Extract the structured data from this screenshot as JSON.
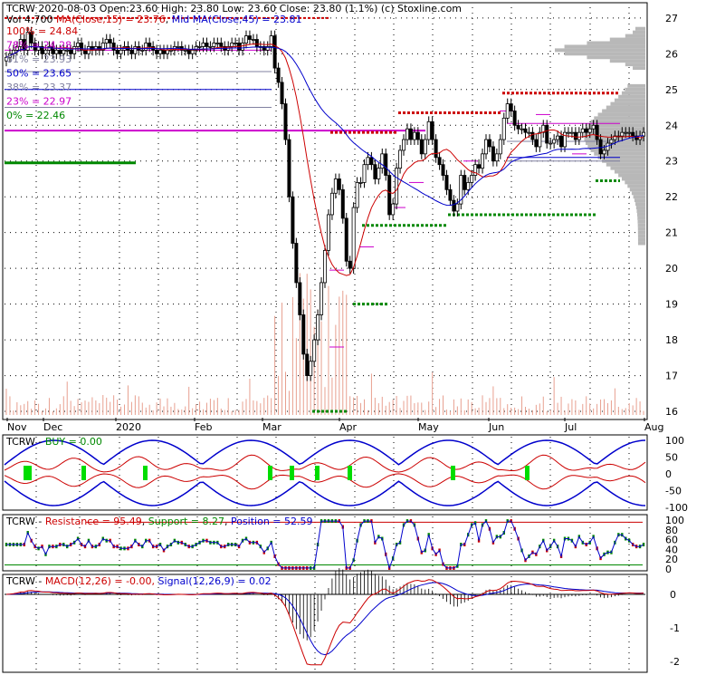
{
  "header": {
    "symbol": "TCRW",
    "date": "2020-08-03",
    "open_label": "Open:",
    "open": "23.60",
    "high_label": "High:",
    "high": "23.80",
    "low_label": "Low:",
    "low": "23.60",
    "close_label": "Close:",
    "close": "23.80",
    "change": "(1.1%)",
    "source": "(c) Stoxline.com"
  },
  "legend": {
    "vol": "Vol 4,700",
    "ma15": "MA(Close,15) = 23.76",
    "ma45": "Mid MA(Close,45) = 23.81"
  },
  "fib_levels": [
    {
      "label": "100% = 24.84",
      "pct": "100%",
      "value": 24.84,
      "color": "#cc0000"
    },
    {
      "label": "78% = 24.28",
      "pct": "78%",
      "value": 24.28,
      "color": "#cc00cc"
    },
    {
      "label": "61% = 23.93",
      "pct": "61%",
      "value": 23.93,
      "color": "#8080a0"
    },
    {
      "label": "50% = 23.65",
      "pct": "50%",
      "value": 23.65,
      "color": "#0000cc"
    },
    {
      "label": "38% = 23.37",
      "pct": "38%",
      "value": 23.37,
      "color": "#8080a0"
    },
    {
      "label": "23% = 22.97",
      "pct": "23%",
      "value": 22.97,
      "color": "#cc00cc"
    },
    {
      "label": "0% = 22.46",
      "pct": "0%",
      "value": 22.46,
      "color": "#008800"
    }
  ],
  "chart_data": {
    "type": "candlestick",
    "price_axis": {
      "ylim": [
        15.9,
        27.3
      ],
      "ticks": [
        16,
        17,
        18,
        19,
        20,
        21,
        22,
        23,
        24,
        25,
        26,
        27
      ]
    },
    "months": [
      "Nov",
      "Dec",
      "2020",
      "Feb",
      "Mar",
      "Apr",
      "May",
      "Jun",
      "Jul",
      "Aug"
    ],
    "closes": [
      25.9,
      26.0,
      26.1,
      26.2,
      26.4,
      26.1,
      26.6,
      26.3,
      26.1,
      26.2,
      26.0,
      26.1,
      26.2,
      26.0,
      26.1,
      26.0,
      26.1,
      26.1,
      26.0,
      26.2,
      26.3,
      26.1,
      26.0,
      26.2,
      26.1,
      26.2,
      26.1,
      26.3,
      26.4,
      26.3,
      26.1,
      26.0,
      26.1,
      26.2,
      26.1,
      26.0,
      26.2,
      26.1,
      26.1,
      26.3,
      26.2,
      26.1,
      26.0,
      26.1,
      26.0,
      26.1,
      26.1,
      26.2,
      26.2,
      26.1,
      26.1,
      26.0,
      26.1,
      26.2,
      26.2,
      26.3,
      26.2,
      26.2,
      26.3,
      26.3,
      26.2,
      26.1,
      26.2,
      26.3,
      26.3,
      26.1,
      26.3,
      26.5,
      26.4,
      26.4,
      26.2,
      26.2,
      26.1,
      26.2,
      26.5,
      25.6,
      25.2,
      24.6,
      23.6,
      22.0,
      20.7,
      19.6,
      18.7,
      17.6,
      17.0,
      17.4,
      18.0,
      18.7,
      19.6,
      20.5,
      21.5,
      22.1,
      22.5,
      22.2,
      21.4,
      20.2,
      20.0,
      21.7,
      22.4,
      22.4,
      22.9,
      23.1,
      22.9,
      22.5,
      22.8,
      23.2,
      22.6,
      21.5,
      21.8,
      22.8,
      23.3,
      23.6,
      23.9,
      23.6,
      23.8,
      23.6,
      23.2,
      23.6,
      24.1,
      23.6,
      23.1,
      22.9,
      22.6,
      22.2,
      21.9,
      21.6,
      21.8,
      22.6,
      22.2,
      22.4,
      22.6,
      22.9,
      22.8,
      23.2,
      23.6,
      23.4,
      23.0,
      23.2,
      23.6,
      24.2,
      24.6,
      24.4,
      24.0,
      23.9,
      23.9,
      23.8,
      23.8,
      23.6,
      23.4,
      23.8,
      24.0,
      23.5,
      23.5,
      23.6,
      23.7,
      23.4,
      23.8,
      23.8,
      23.8,
      23.6,
      23.8,
      23.9,
      23.8,
      23.9,
      24.0,
      23.6,
      23.2,
      23.3,
      23.5,
      23.6,
      23.7,
      23.7,
      23.8,
      23.8,
      23.8,
      23.7,
      23.6,
      23.7,
      23.8
    ],
    "oscillator_axis": {
      "ticks": [
        100,
        50,
        0,
        -50,
        -100
      ]
    },
    "rsp_axis": {
      "ticks": [
        100,
        80,
        60,
        40,
        20,
        0
      ]
    },
    "macd_axis": {
      "ticks": [
        0,
        -1,
        -2
      ]
    }
  },
  "buy_panel": {
    "label_sym": "TCRW",
    "label": "BUY = 0.00"
  },
  "rsp_panel": {
    "label_sym": "TCRW",
    "resistance": "Resistance = 95.49",
    "support": "Support = 8.27",
    "position": "Position = 52.59"
  },
  "macd_panel": {
    "label_sym": "TCRW",
    "macd": "MACD(12,26) = -0.00,",
    "signal": "Signal(12,26,9) = 0.02"
  },
  "colors": {
    "up": "#008800",
    "down": "#cc0000",
    "ma15": "#cc0000",
    "ma45": "#0000cc",
    "volume": "#e8a090",
    "support": "#008800",
    "resistance": "#cc0000",
    "grid": "#000000"
  }
}
